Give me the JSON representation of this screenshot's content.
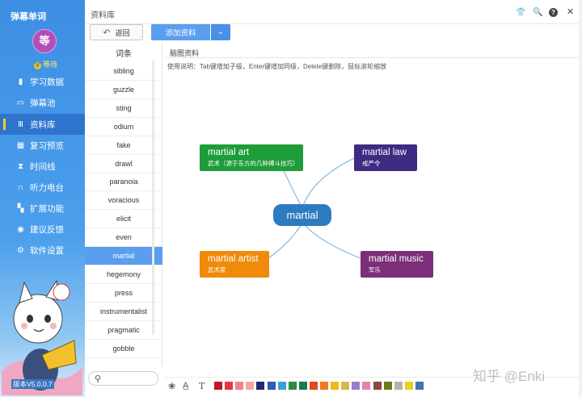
{
  "app": {
    "title": "弹幕单词",
    "avatar_text": "等",
    "level_badge": "V",
    "level_text": "等待",
    "version": "版本V5.0.0.7"
  },
  "nav": [
    {
      "label": "学习数据",
      "icon": "bar-chart-icon"
    },
    {
      "label": "弹幕池",
      "icon": "screen-icon"
    },
    {
      "label": "资料库",
      "icon": "library-icon",
      "active": true
    },
    {
      "label": "复习预览",
      "icon": "calendar-icon"
    },
    {
      "label": "时间线",
      "icon": "hourglass-icon"
    },
    {
      "label": "听力电台",
      "icon": "headphones-icon"
    },
    {
      "label": "扩展功能",
      "icon": "grid-icon"
    },
    {
      "label": "建议反馈",
      "icon": "location-icon"
    },
    {
      "label": "软件设置",
      "icon": "gear-icon"
    }
  ],
  "header": {
    "section_title": "资料库"
  },
  "toolbar": {
    "back_label": "返回",
    "add_label": "添加资料"
  },
  "word_list": {
    "header": "词条",
    "words": [
      "sibling",
      "guzzle",
      "sting",
      "odium",
      "fake",
      "drawl",
      "paranoia",
      "voracious",
      "elicit",
      "even",
      "martial",
      "hegemony",
      "press",
      "instrumentalist",
      "pragmatic",
      "gobble"
    ],
    "selected": "martial"
  },
  "content": {
    "tab": "脑图资料",
    "usage_tip": "使用说明：Tab键增加子级，Enter键增加同级，Delete键删除，鼠标滚轮缩放"
  },
  "mindmap": {
    "center": "martial",
    "branches": [
      {
        "word": "martial art",
        "meaning": "武术（源于东方的几种搏斗技巧）",
        "color": "#1f9c3a"
      },
      {
        "word": "martial law",
        "meaning": "戒严令",
        "color": "#3e2b82"
      },
      {
        "word": "martial artist",
        "meaning": "武术家",
        "color": "#f08a0b"
      },
      {
        "word": "martial music",
        "meaning": "军乐",
        "color": "#7b2f78"
      }
    ]
  },
  "palette": [
    "#c0172b",
    "#e03a45",
    "#f2828e",
    "#f4a6a0",
    "#1c2c6e",
    "#2f5bb4",
    "#38a1d6",
    "#2e8b3a",
    "#1a7a4d",
    "#e04b1a",
    "#f07a1b",
    "#f4b81f",
    "#d8b84a",
    "#9c7cc7",
    "#e384b1",
    "#8a4a3a",
    "#6b7b1a",
    "#b3b3b3",
    "#e6d21a",
    "#4a6fb0"
  ],
  "watermark": "知乎 @Enki"
}
